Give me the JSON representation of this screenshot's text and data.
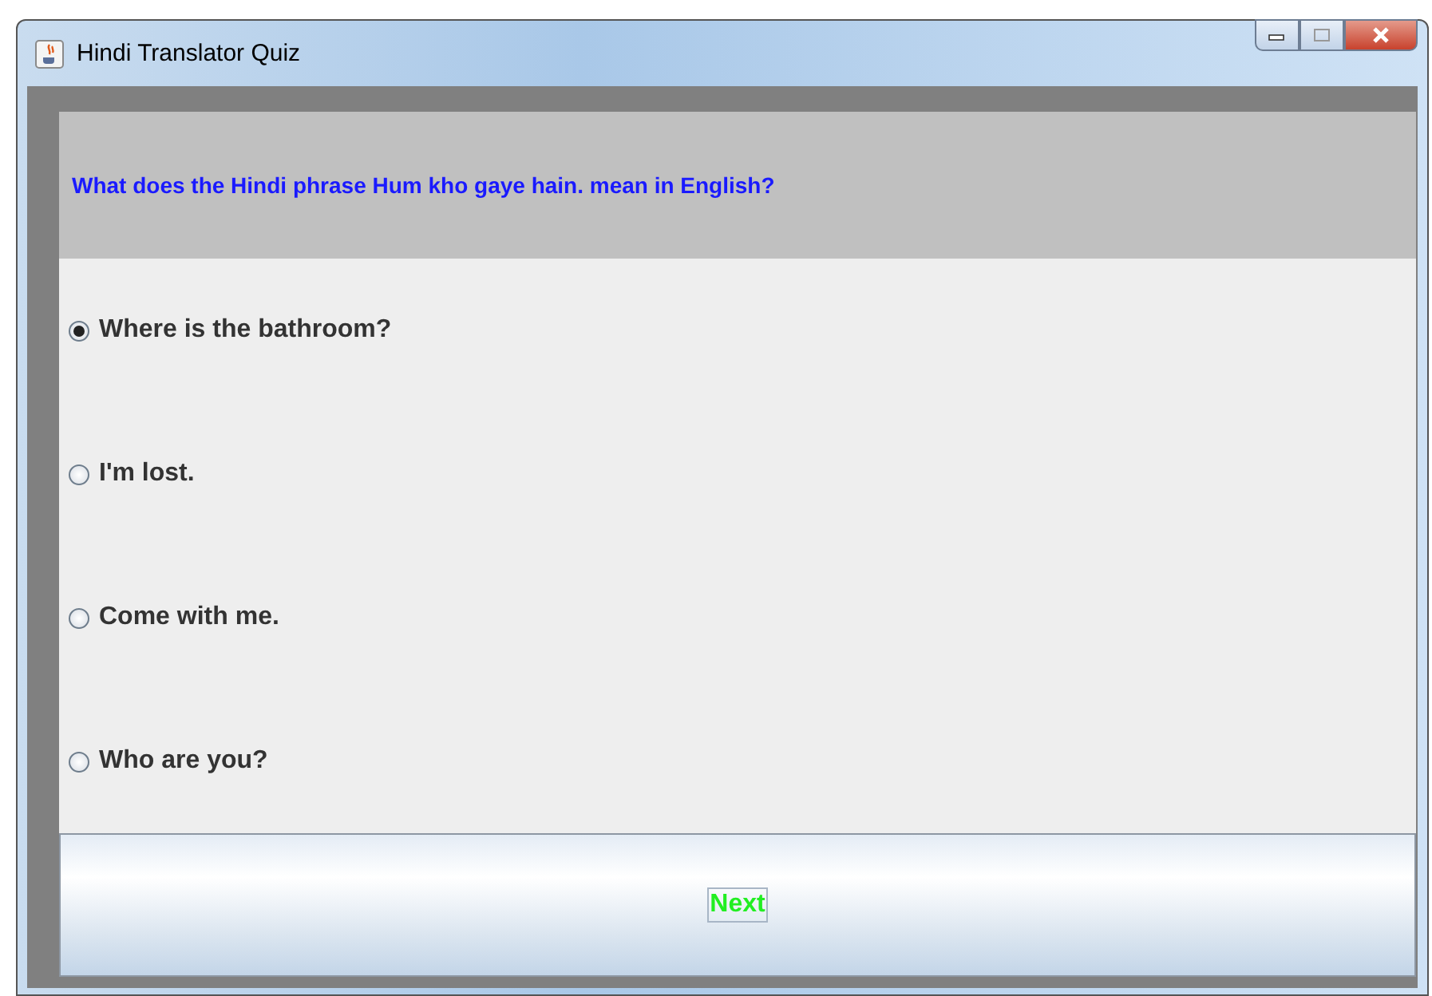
{
  "window": {
    "title": "Hindi Translator Quiz"
  },
  "question": "What does the Hindi phrase Hum kho gaye hain. mean in English?",
  "options": [
    {
      "label": "Where is the bathroom?",
      "selected": true
    },
    {
      "label": "I'm lost.",
      "selected": false
    },
    {
      "label": "Come with me.",
      "selected": false
    },
    {
      "label": "Who are you?",
      "selected": false
    }
  ],
  "next_button": {
    "label": "Next"
  }
}
